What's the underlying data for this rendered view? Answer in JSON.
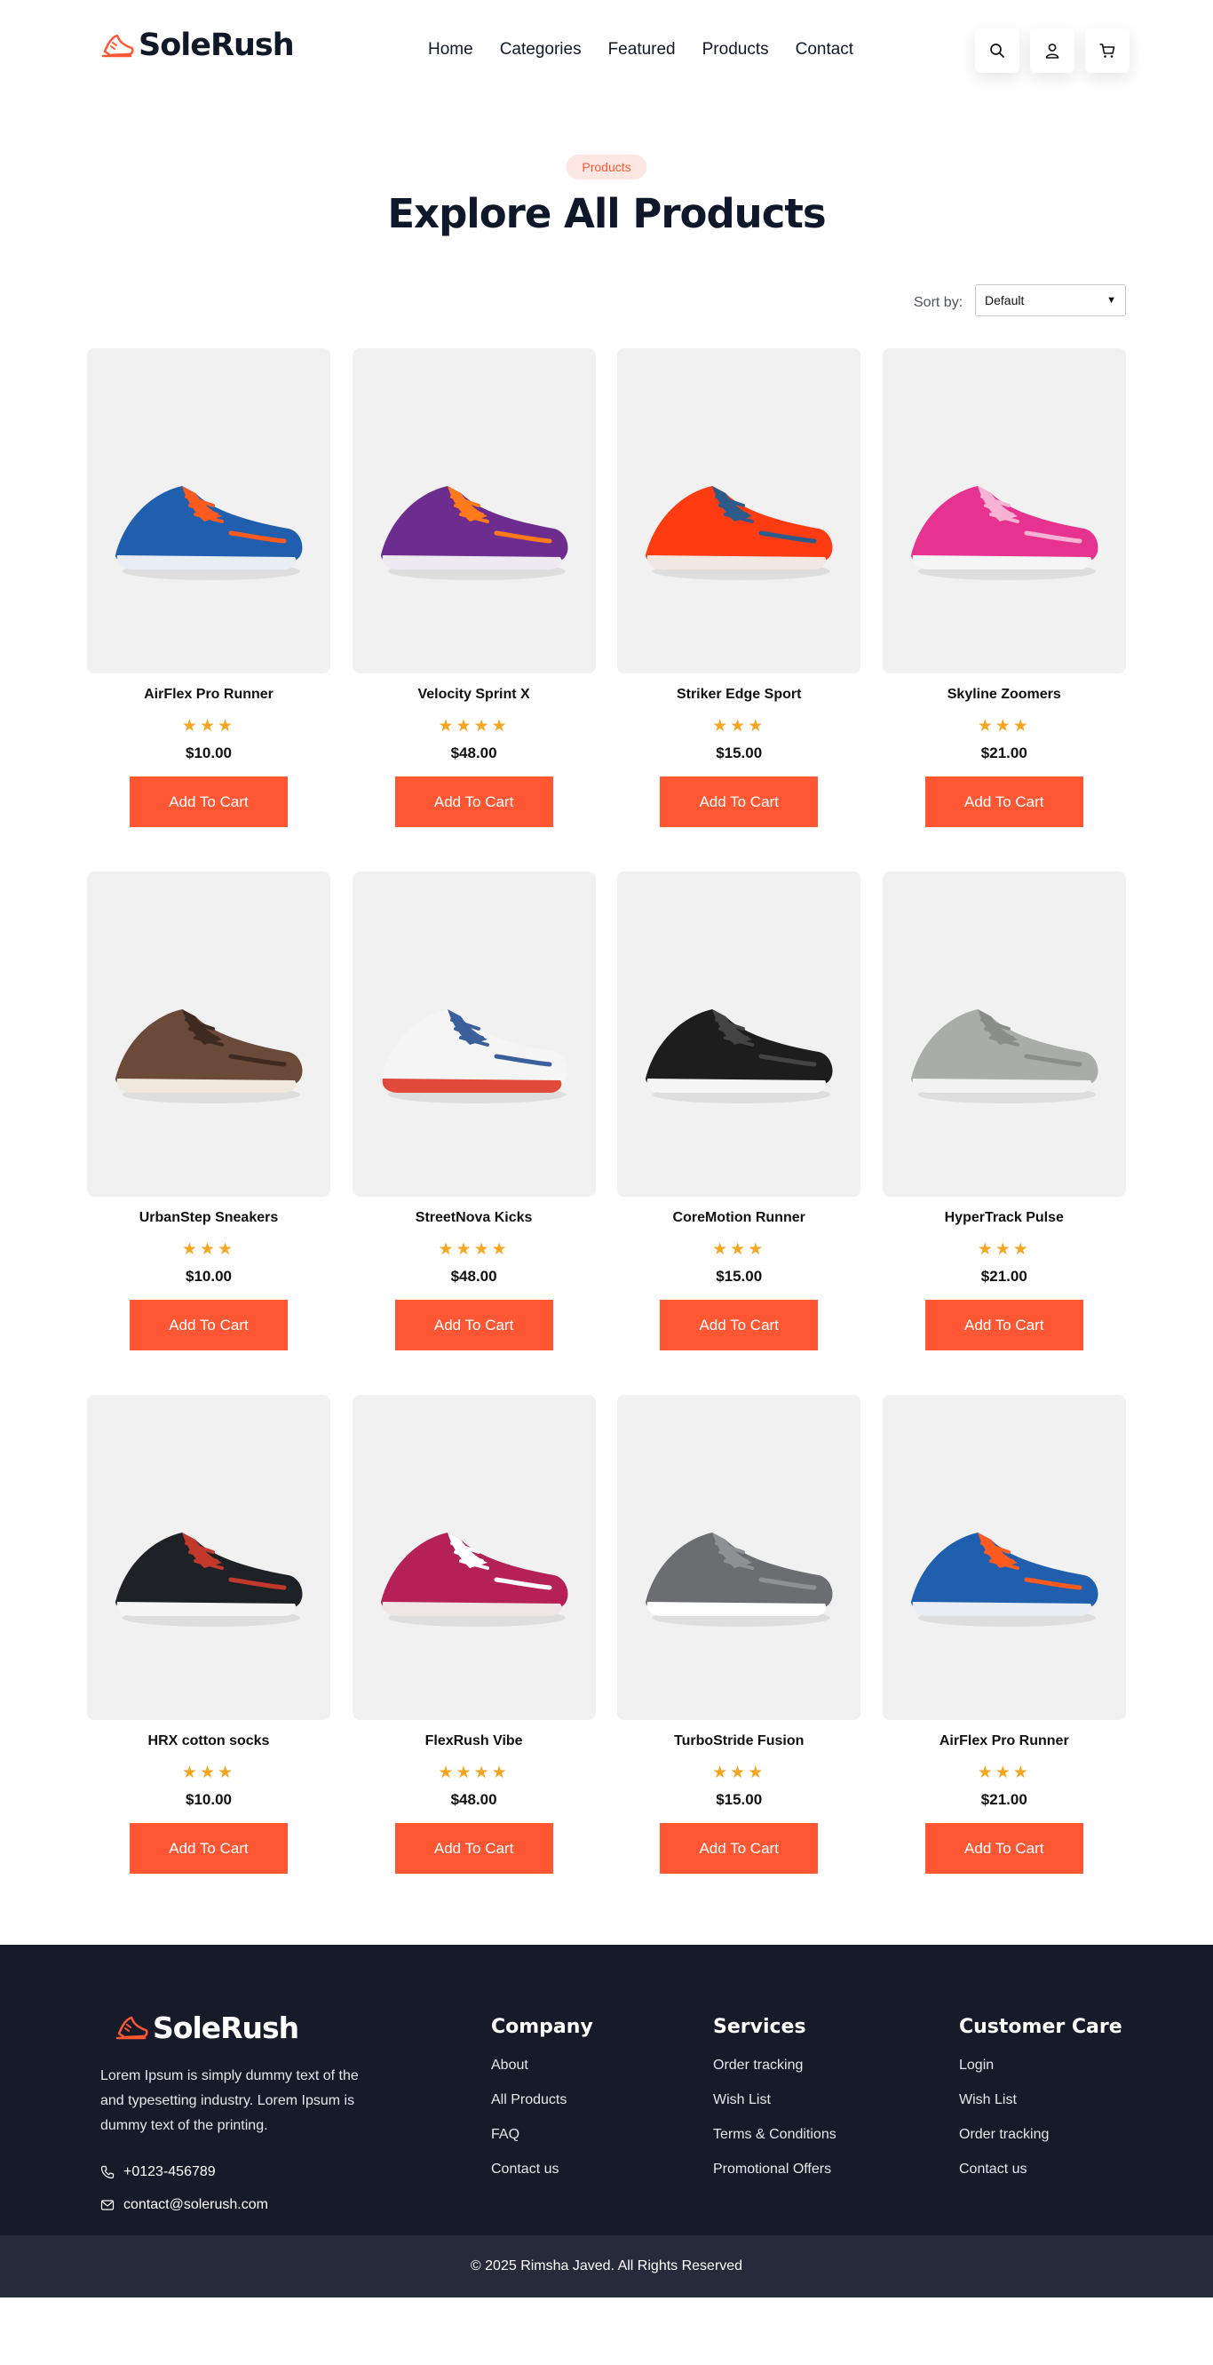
{
  "brand": {
    "name": "SoleRush",
    "accent_color": "#ff5733",
    "dark_color": "#171a28"
  },
  "nav": {
    "items": [
      "Home",
      "Categories",
      "Featured",
      "Products",
      "Contact"
    ]
  },
  "header_icons": [
    "search-icon",
    "user-icon",
    "cart-icon"
  ],
  "section": {
    "badge": "Products",
    "title": "Explore All Products"
  },
  "sort": {
    "label": "Sort by:",
    "selected": "Default"
  },
  "products": [
    {
      "name": "AirFlex Pro Runner",
      "rating": 3,
      "price": "$10.00",
      "button": "Add To Cart",
      "image": "blue-orange-running-shoe"
    },
    {
      "name": "Velocity Sprint X",
      "rating": 4,
      "price": "$48.00",
      "button": "Add To Cart",
      "image": "purple-orange-sneaker"
    },
    {
      "name": "Striker Edge Sport",
      "rating": 3,
      "price": "$15.00",
      "button": "Add To Cart",
      "image": "red-blue-running-shoe"
    },
    {
      "name": "Skyline Zoomers",
      "rating": 3,
      "price": "$21.00",
      "button": "Add To Cart",
      "image": "pink-sneaker-pair"
    },
    {
      "name": "UrbanStep Sneakers",
      "rating": 3,
      "price": "$10.00",
      "button": "Add To Cart",
      "image": "brown-leather-sneaker"
    },
    {
      "name": "StreetNova Kicks",
      "rating": 4,
      "price": "$48.00",
      "button": "Add To Cart",
      "image": "argyle-canvas-sneaker-pair"
    },
    {
      "name": "CoreMotion Runner",
      "rating": 3,
      "price": "$15.00",
      "button": "Add To Cart",
      "image": "black-sneaker-pair"
    },
    {
      "name": "HyperTrack Pulse",
      "rating": 3,
      "price": "$21.00",
      "button": "Add To Cart",
      "image": "grey-high-top-pair"
    },
    {
      "name": "HRX cotton socks",
      "rating": 3,
      "price": "$10.00",
      "button": "Add To Cart",
      "image": "black-red-sneaker-pair"
    },
    {
      "name": "FlexRush Vibe",
      "rating": 4,
      "price": "$48.00",
      "button": "Add To Cart",
      "image": "maroon-canvas-sneaker-pair"
    },
    {
      "name": "TurboStride Fusion",
      "rating": 3,
      "price": "$15.00",
      "button": "Add To Cart",
      "image": "grey-slip-on-pair"
    },
    {
      "name": "AirFlex Pro Runner",
      "rating": 3,
      "price": "$21.00",
      "button": "Add To Cart",
      "image": "blue-orange-running-shoe"
    }
  ],
  "footer": {
    "about": "Lorem Ipsum is simply dummy text of the and typesetting industry. Lorem Ipsum is dummy text of the printing.",
    "phone": "+0123-456789",
    "email": "contact@solerush.com",
    "social_icons": [
      "facebook-icon",
      "twitter-icon",
      "linkedin-icon",
      "youtube-icon"
    ],
    "columns": [
      {
        "title": "Company",
        "links": [
          "About",
          "All Products",
          "FAQ",
          "Contact us"
        ]
      },
      {
        "title": "Services",
        "links": [
          "Order tracking",
          "Wish List",
          "Terms & Conditions",
          "Promotional Offers"
        ]
      },
      {
        "title": "Customer Care",
        "links": [
          "Login",
          "Wish List",
          "Order tracking",
          "Contact us"
        ]
      }
    ],
    "copyright": "© 2025 Rimsha Javed. All Rights Reserved"
  }
}
